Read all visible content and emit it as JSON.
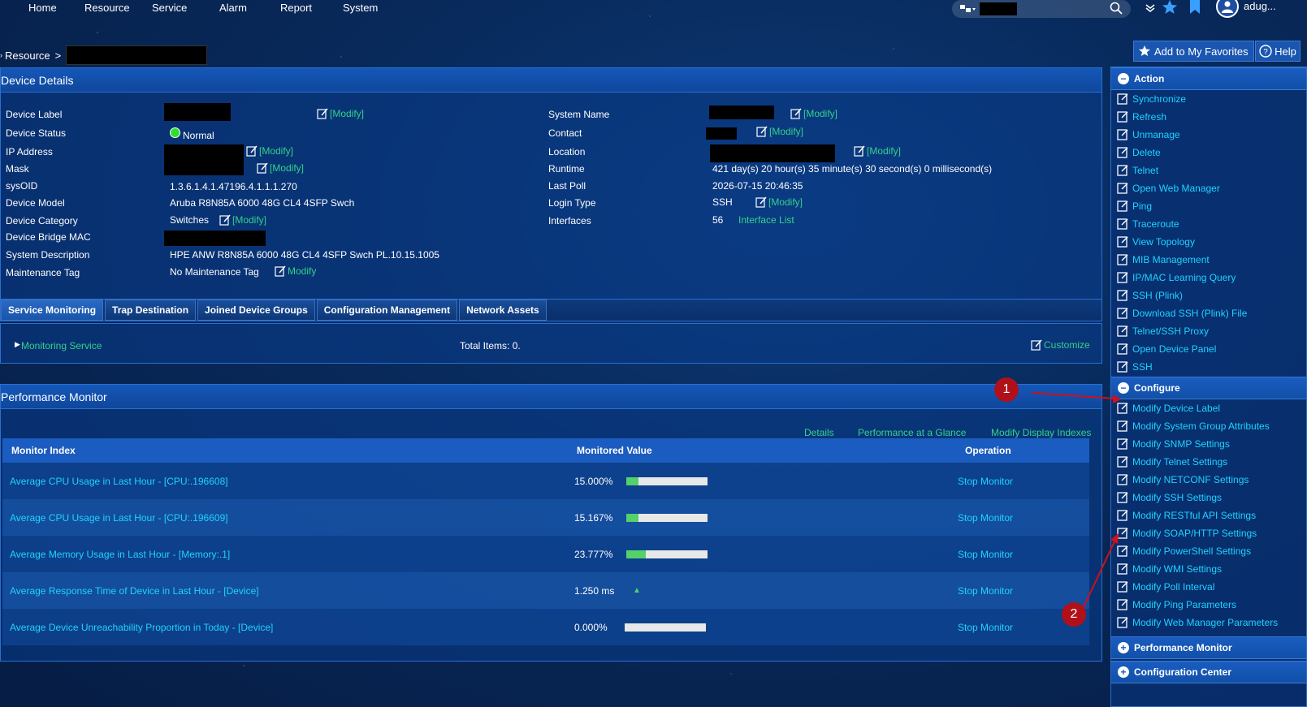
{
  "nav": {
    "items": [
      "Home",
      "Resource",
      "Service",
      "Alarm",
      "Report",
      "System"
    ],
    "username": "adug..."
  },
  "breadcrumb": {
    "prefix": "Resource",
    "separator": ">"
  },
  "toolbar": {
    "favorites_label": "Add to My Favorites",
    "help_label": "Help"
  },
  "device_details": {
    "title": "Device Details",
    "modify_label": "[Modify]",
    "left_fields": [
      {
        "label": "Device Label",
        "value": ""
      },
      {
        "label": "Device Status",
        "value": "Normal"
      },
      {
        "label": "IP Address",
        "value": ""
      },
      {
        "label": "Mask",
        "value": ""
      },
      {
        "label": "sysOID",
        "value": "1.3.6.1.4.1.47196.4.1.1.1.270"
      },
      {
        "label": "Device Model",
        "value": "Aruba R8N85A 6000 48G CL4 4SFP Swch"
      },
      {
        "label": "Device Category",
        "value": "Switches"
      },
      {
        "label": "Device Bridge MAC",
        "value": ""
      },
      {
        "label": "System Description",
        "value": "HPE ANW R8N85A 6000 48G CL4 4SFP Swch PL.10.15.1005"
      },
      {
        "label": "Maintenance Tag",
        "value": "No Maintenance Tag"
      }
    ],
    "maintenance_modify": "Modify",
    "right_fields": [
      {
        "label": "System Name",
        "value": ""
      },
      {
        "label": "Contact",
        "value": ""
      },
      {
        "label": "Location",
        "value": ""
      },
      {
        "label": "Runtime",
        "value": "421 day(s) 20 hour(s) 35 minute(s) 30 second(s) 0 millisecond(s)"
      },
      {
        "label": "Last Poll",
        "value": "2026-07-15 20:46:35"
      },
      {
        "label": "Login Type",
        "value": "SSH"
      },
      {
        "label": "Interfaces",
        "value": "56"
      }
    ],
    "interface_list_link": "Interface List"
  },
  "tabs": [
    {
      "label": "Service Monitoring",
      "active": true
    },
    {
      "label": "Trap Destination",
      "active": false
    },
    {
      "label": "Joined Device Groups",
      "active": false
    },
    {
      "label": "Configuration Management",
      "active": false
    },
    {
      "label": "Network Assets",
      "active": false
    }
  ],
  "service_monitoring": {
    "link": "Monitoring Service",
    "total": "Total Items: 0.",
    "customize": "Customize"
  },
  "performance_monitor": {
    "title": "Performance Monitor",
    "links": [
      "Details",
      "Performance at a Glance",
      "Modify Display Indexes"
    ],
    "columns": [
      "Monitor Index",
      "Monitored Value",
      "Operation"
    ],
    "rows": [
      {
        "index": "Average CPU Usage in Last Hour - [CPU:.196608]",
        "value": "15.000%",
        "bar": 0.15,
        "op": "Stop Monitor"
      },
      {
        "index": "Average CPU Usage in Last Hour - [CPU:.196609]",
        "value": "15.167%",
        "bar": 0.15167,
        "op": "Stop Monitor"
      },
      {
        "index": "Average Memory Usage in Last Hour - [Memory:.1]",
        "value": "23.777%",
        "bar": 0.23777,
        "op": "Stop Monitor"
      },
      {
        "index": "Average Response Time of Device in Last Hour - [Device]",
        "value": "1.250 ms",
        "bar": null,
        "op": "Stop Monitor"
      },
      {
        "index": "Average Device Unreachability Proportion in Today - [Device]",
        "value": "0.000%",
        "bar": 0,
        "op": "Stop Monitor"
      }
    ]
  },
  "sidebar": {
    "action_title": "Action",
    "action_items": [
      {
        "label": "Synchronize",
        "icon": "sync-icon"
      },
      {
        "label": "Refresh",
        "icon": "refresh-icon"
      },
      {
        "label": "Unmanage",
        "icon": "unmanage-icon"
      },
      {
        "label": "Delete",
        "icon": "trash-icon"
      },
      {
        "label": "Telnet",
        "icon": "telnet-icon"
      },
      {
        "label": "Open Web Manager",
        "icon": "web-manager-icon"
      },
      {
        "label": "Ping",
        "icon": "ping-icon"
      },
      {
        "label": "Traceroute",
        "icon": "traceroute-icon"
      },
      {
        "label": "View Topology",
        "icon": "topology-icon"
      },
      {
        "label": "MIB Management",
        "icon": "wrench-icon"
      },
      {
        "label": "IP/MAC Learning Query",
        "icon": "query-icon"
      },
      {
        "label": "SSH (Plink)",
        "icon": "ssh-plink-icon"
      },
      {
        "label": "Download SSH (Plink) File",
        "icon": "download-icon"
      },
      {
        "label": "Telnet/SSH Proxy",
        "icon": "proxy-icon"
      },
      {
        "label": "Open Device Panel",
        "icon": "panel-icon"
      },
      {
        "label": "SSH",
        "icon": "ssh-icon"
      }
    ],
    "configure_title": "Configure",
    "configure_items": [
      {
        "label": "Modify Device Label",
        "icon": "edit-icon"
      },
      {
        "label": "Modify System Group Attributes",
        "icon": "edit-icon"
      },
      {
        "label": "Modify SNMP Settings",
        "icon": "snmp-icon"
      },
      {
        "label": "Modify Telnet Settings",
        "icon": "telnet-settings-icon"
      },
      {
        "label": "Modify NETCONF Settings",
        "icon": "netconf-icon"
      },
      {
        "label": "Modify SSH Settings",
        "icon": "ssh-settings-icon"
      },
      {
        "label": "Modify RESTful API Settings",
        "icon": "rest-icon"
      },
      {
        "label": "Modify SOAP/HTTP Settings",
        "icon": "soap-icon"
      },
      {
        "label": "Modify PowerShell Settings",
        "icon": "powershell-icon"
      },
      {
        "label": "Modify WMI Settings",
        "icon": "wmi-icon"
      },
      {
        "label": "Modify Poll Interval",
        "icon": "poll-icon"
      },
      {
        "label": "Modify Ping Parameters",
        "icon": "ping-params-icon"
      },
      {
        "label": "Modify Web Manager Parameters",
        "icon": "web-params-icon"
      }
    ],
    "perf_title": "Performance Monitor",
    "config_center_title": "Configuration Center"
  },
  "markers": [
    "1",
    "2"
  ],
  "colors": {
    "link": "#1ed3ff",
    "modify": "#34d28a",
    "bar_fill": "#54d16b",
    "status_ok": "#2ee02e",
    "marker": "#b0101a"
  }
}
